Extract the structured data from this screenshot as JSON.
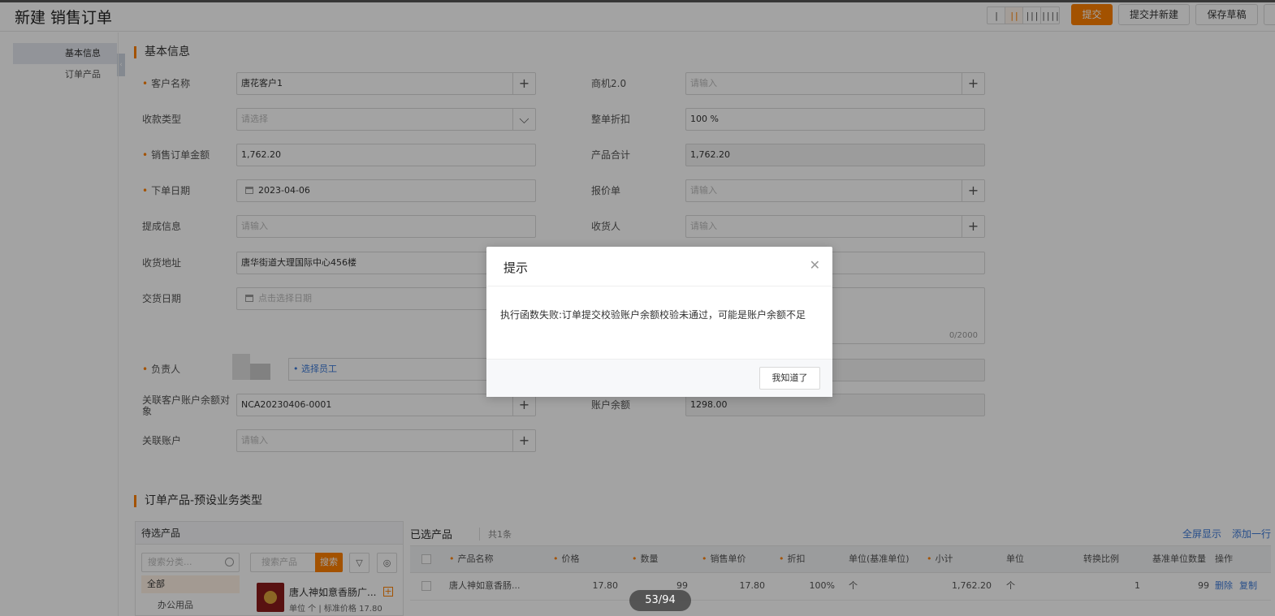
{
  "header": {
    "title": "新建 销售订单",
    "layout_options": [
      "|",
      "||",
      "|||",
      "||||"
    ],
    "submit_label": "提交",
    "submit_new_label": "提交并新建",
    "save_draft_label": "保存草稿"
  },
  "sidenav": {
    "items": [
      "基本信息",
      "订单产品"
    ]
  },
  "basic": {
    "section_title": "基本信息",
    "customer_label": "客户名称",
    "customer_value": "唐花客户1",
    "opportunity_label": "商机2.0",
    "opportunity_placeholder": "请输入",
    "payment_type_label": "收款类型",
    "payment_type_placeholder": "请选择",
    "discount_label": "整单折扣",
    "discount_value": "100 %",
    "order_amount_label": "销售订单金额",
    "order_amount_value": "1,762.20",
    "product_total_label": "产品合计",
    "product_total_value": "1,762.20",
    "order_date_label": "下单日期",
    "order_date_value": "2023-04-06",
    "quote_label": "报价单",
    "quote_placeholder": "请输入",
    "commission_label": "提成信息",
    "commission_placeholder": "请输入",
    "receiver_label": "收货人",
    "receiver_placeholder": "请输入",
    "address_label": "收货地址",
    "address_value": "唐华街道大理国际中心456楼",
    "delivery_date_label": "交货日期",
    "delivery_date_placeholder": "点击选择日期",
    "remark_counter": "0/2000",
    "owner_label": "负责人",
    "owner_select": "• 选择员工",
    "linked_account_obj_label": "关联客户账户余额对象",
    "linked_account_obj_value": "NCA20230406-0001",
    "balance_label": "账户余额",
    "balance_value": "1298.00",
    "linked_account_label": "关联账户",
    "linked_account_placeholder": "请输入"
  },
  "products": {
    "section_title": "订单产品-预设业务类型",
    "candidates_title": "待选产品",
    "category_search_placeholder": "搜索分类...",
    "category_all": "全部",
    "category_office": "办公用品",
    "product_search_placeholder": "搜索产品",
    "search_button": "搜索",
    "candidate_name": "唐人神如意香肠广...",
    "candidate_meta": "单位 个 | 标准价格 17.80",
    "selected_title": "已选产品",
    "selected_count": "共1条",
    "fullscreen_label": "全屏显示",
    "add_row_label": "添加一行",
    "columns": [
      "产品名称",
      "价格",
      "数量",
      "销售单价",
      "折扣",
      "单位(基准单位)",
      "小计",
      "单位",
      "转换比例",
      "基准单位数量",
      "操作"
    ],
    "row": {
      "name": "唐人神如意香肠...",
      "price": "17.80",
      "qty": "99",
      "sale_price": "17.80",
      "discount": "100%",
      "base_unit": "个",
      "subtotal": "1,762.20",
      "unit": "个",
      "ratio": "1",
      "base_qty": "99",
      "delete": "删除",
      "copy": "复制"
    }
  },
  "modal": {
    "title": "提示",
    "message": "执行函数失败:订单提交校验账户余额校验未通过，可能是账户余额不足",
    "ok_label": "我知道了"
  },
  "pager": "53/94",
  "colors": {
    "accent": "#ff8000",
    "link": "#3e7bd8"
  }
}
